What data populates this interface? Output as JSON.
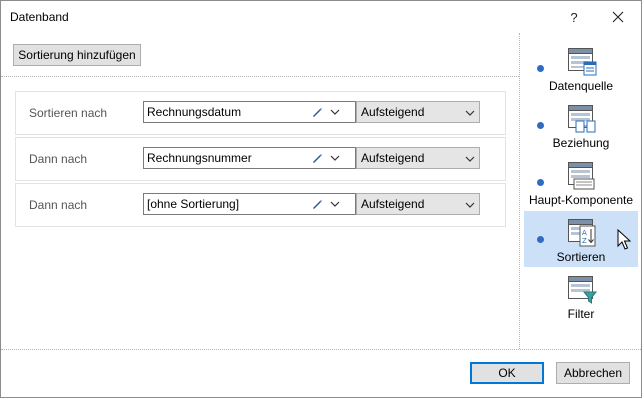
{
  "dialog": {
    "title": "Datenband",
    "help_label": "?"
  },
  "toolbar": {
    "add_sort_label": "Sortierung hinzufügen"
  },
  "sort_rows": [
    {
      "label": "Sortieren nach",
      "field": "Rechnungsdatum",
      "order": "Aufsteigend"
    },
    {
      "label": "Dann nach",
      "field": "Rechnungsnummer",
      "order": "Aufsteigend"
    },
    {
      "label": "Dann nach",
      "field": "[ohne Sortierung]",
      "order": "Aufsteigend"
    }
  ],
  "steps": [
    {
      "label": "Datenquelle",
      "icon": "datasource-icon",
      "completed": true,
      "active": false
    },
    {
      "label": "Beziehung",
      "icon": "relation-icon",
      "completed": true,
      "active": false
    },
    {
      "label": "Haupt-Komponente",
      "icon": "main-component-icon",
      "completed": true,
      "active": false
    },
    {
      "label": "Sortieren",
      "icon": "sort-az-icon",
      "completed": true,
      "active": true
    },
    {
      "label": "Filter",
      "icon": "filter-icon",
      "completed": false,
      "active": false
    }
  ],
  "footer": {
    "ok_label": "OK",
    "cancel_label": "Abbrechen"
  },
  "colors": {
    "active_step_bg": "#cce1f8",
    "step_dot": "#2d6cc0",
    "default_button_border": "#0078d7"
  }
}
